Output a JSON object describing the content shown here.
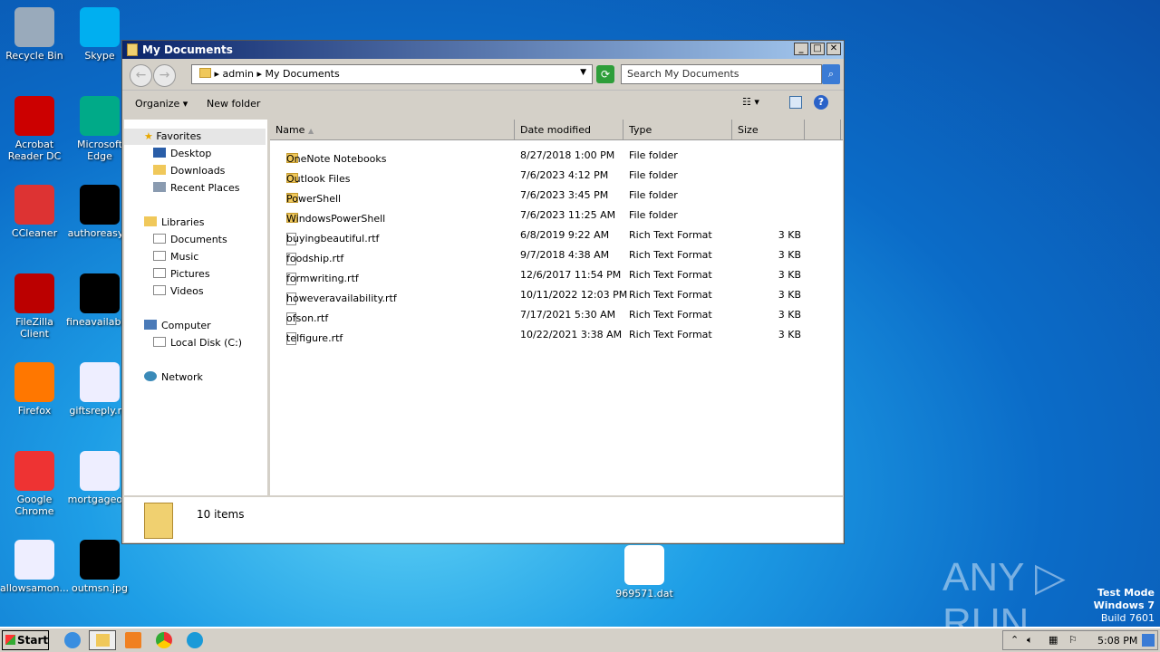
{
  "desktop": {
    "icons": [
      {
        "label": "Recycle Bin",
        "color": "#9ab"
      },
      {
        "label": "Skype",
        "color": "#00aff0"
      },
      {
        "label": "Acrobat Reader DC",
        "color": "#c00"
      },
      {
        "label": "Microsoft Edge",
        "color": "#0a8"
      },
      {
        "label": "CCleaner",
        "color": "#d33"
      },
      {
        "label": "authoreasy...",
        "color": "#000"
      },
      {
        "label": "FileZilla Client",
        "color": "#b00"
      },
      {
        "label": "fineavailabl...",
        "color": "#000"
      },
      {
        "label": "Firefox",
        "color": "#f70"
      },
      {
        "label": "giftsreply.r...",
        "color": "#eef"
      },
      {
        "label": "Google Chrome",
        "color": "#e33"
      },
      {
        "label": "mortgageo...",
        "color": "#eef"
      },
      {
        "label": "allowsamon...",
        "color": "#eef"
      },
      {
        "label": "outmsn.jpg",
        "color": "#000"
      },
      {
        "label": "969571.dat",
        "color": "#fff"
      }
    ],
    "watermark": "ANY ▷ RUN",
    "test_mode": "Test Mode",
    "os": "Windows 7",
    "build": "Build 7601"
  },
  "window": {
    "title": "My Documents",
    "address": {
      "parts": [
        "admin",
        "My Documents"
      ]
    },
    "search_placeholder": "Search My Documents",
    "toolbar": {
      "organize": "Organize",
      "new_folder": "New folder"
    },
    "sidebar": {
      "favorites": "Favorites",
      "desktop": "Desktop",
      "downloads": "Downloads",
      "recent": "Recent Places",
      "libraries": "Libraries",
      "documents": "Documents",
      "music": "Music",
      "pictures": "Pictures",
      "videos": "Videos",
      "computer": "Computer",
      "local_disk": "Local Disk (C:)",
      "network": "Network"
    },
    "columns": [
      "Name",
      "Date modified",
      "Type",
      "Size"
    ],
    "files": [
      {
        "name": "OneNote Notebooks",
        "date": "8/27/2018 1:00 PM",
        "type": "File folder",
        "size": "",
        "folder": true
      },
      {
        "name": "Outlook Files",
        "date": "7/6/2023 4:12 PM",
        "type": "File folder",
        "size": "",
        "folder": true
      },
      {
        "name": "PowerShell",
        "date": "7/6/2023 3:45 PM",
        "type": "File folder",
        "size": "",
        "folder": true
      },
      {
        "name": "WindowsPowerShell",
        "date": "7/6/2023 11:25 AM",
        "type": "File folder",
        "size": "",
        "folder": true
      },
      {
        "name": "buyingbeautiful.rtf",
        "date": "6/8/2019 9:22 AM",
        "type": "Rich Text Format",
        "size": "3 KB"
      },
      {
        "name": "foodship.rtf",
        "date": "9/7/2018 4:38 AM",
        "type": "Rich Text Format",
        "size": "3 KB"
      },
      {
        "name": "formwriting.rtf",
        "date": "12/6/2017 11:54 PM",
        "type": "Rich Text Format",
        "size": "3 KB"
      },
      {
        "name": "howeveravailability.rtf",
        "date": "10/11/2022 12:03 PM",
        "type": "Rich Text Format",
        "size": "3 KB"
      },
      {
        "name": "ofson.rtf",
        "date": "7/17/2021 5:30 AM",
        "type": "Rich Text Format",
        "size": "3 KB"
      },
      {
        "name": "telfigure.rtf",
        "date": "10/22/2021 3:38 AM",
        "type": "Rich Text Format",
        "size": "3 KB"
      }
    ],
    "status": "10 items"
  },
  "taskbar": {
    "start": "Start",
    "clock": "5:08 PM"
  }
}
